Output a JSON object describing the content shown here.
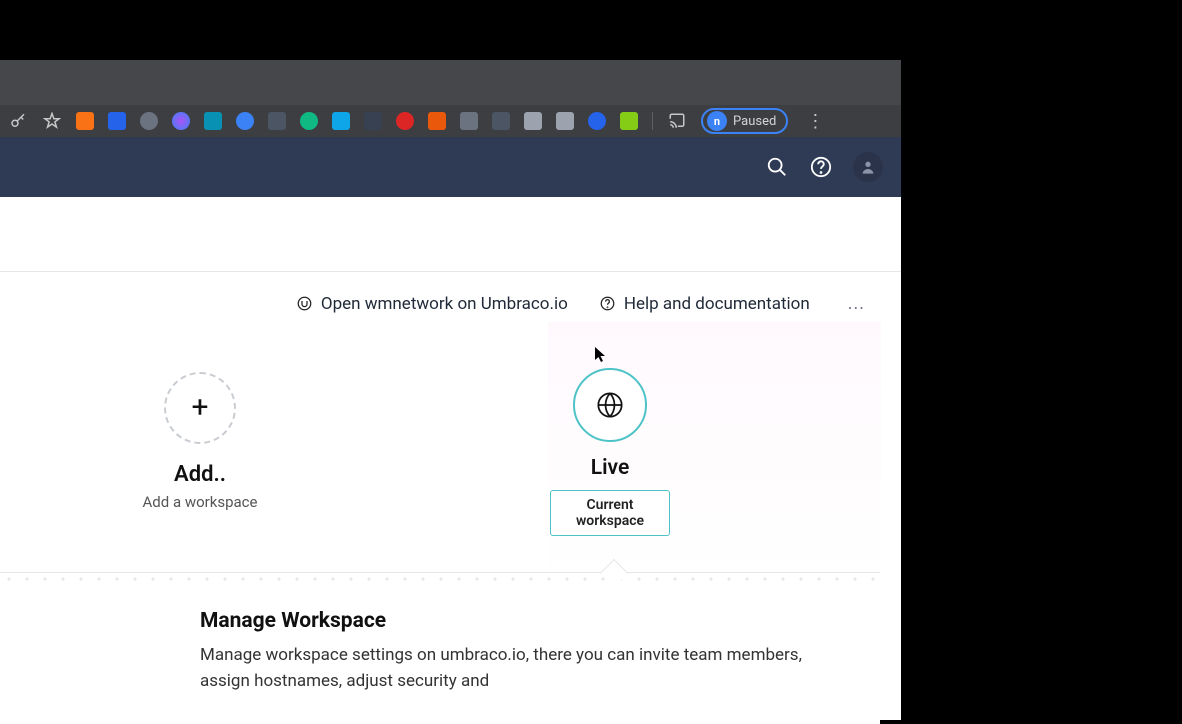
{
  "browser": {
    "paused_label": "Paused",
    "paused_badge": "n"
  },
  "header": {},
  "links": {
    "open_project": "Open wmnetwork on Umbraco.io",
    "help": "Help and documentation",
    "more": "..."
  },
  "workspaces": {
    "add": {
      "title": "Add..",
      "subtitle": "Add a workspace"
    },
    "live": {
      "title": "Live",
      "badge": "Current workspace"
    }
  },
  "manage": {
    "title": "Manage Workspace",
    "body": "Manage workspace settings on umbraco.io, there you can invite team members, assign hostnames, adjust security and"
  }
}
